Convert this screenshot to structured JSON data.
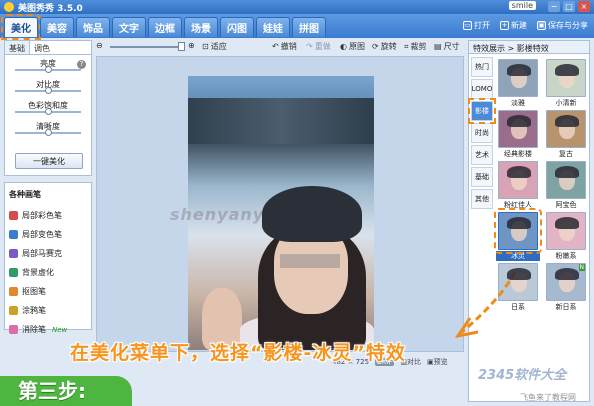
{
  "window": {
    "title": "美图秀秀 3.5.0",
    "user": "smile",
    "buttons": [
      "−",
      "□",
      "×"
    ]
  },
  "main_tabs": [
    "美化",
    "美容",
    "饰品",
    "文字",
    "边框",
    "场景",
    "闪图",
    "娃娃",
    "拼图"
  ],
  "top_actions": {
    "open": "打开",
    "new": "新建",
    "save_share": "保存与分享"
  },
  "left_panel": {
    "tabs": [
      "基础",
      "调色"
    ],
    "help": "?",
    "sliders": [
      {
        "label": "亮度",
        "value": 0.5
      },
      {
        "label": "对比度",
        "value": 0.5
      },
      {
        "label": "色彩饱和度",
        "value": 0.5
      },
      {
        "label": "清晰度",
        "value": 0.5
      }
    ],
    "onekey_button": "一键美化"
  },
  "brush_panel": {
    "title": "各种画笔",
    "items": [
      {
        "label": "局部彩色笔",
        "color": "#d64b4b"
      },
      {
        "label": "局部变色笔",
        "color": "#3b7bd0"
      },
      {
        "label": "局部马赛克",
        "color": "#7c5bc6"
      },
      {
        "label": "背景虚化",
        "color": "#2f9b6b"
      },
      {
        "label": "抠图笔",
        "color": "#e28a2b"
      },
      {
        "label": "涂鸦笔",
        "color": "#c9a227"
      },
      {
        "label": "消除笔",
        "color": "#e06aa8",
        "badge": "New"
      }
    ]
  },
  "toolbar": {
    "fit": "适应",
    "undo": "撤销",
    "redo": "重做",
    "original": "原图",
    "rotate": "旋转",
    "crop": "裁剪",
    "size": "尺寸"
  },
  "canvas": {
    "watermark": "shenyanya",
    "status": {
      "dimensions": "482 × 725",
      "exif": "EXIF",
      "compare": "对比",
      "preview": "预览"
    }
  },
  "right_panel": {
    "header": "特效展示 > 影楼特效",
    "categories": [
      "热门",
      "LOMO",
      "影楼",
      "时尚",
      "艺术",
      "基础",
      "其他"
    ],
    "active_category": "影楼",
    "thumbs": [
      {
        "label": "淡雅",
        "tone": "#8fa3b9"
      },
      {
        "label": "小清新",
        "tone": "#c7d6c8"
      },
      {
        "label": "经典影楼",
        "tone": "#9a6e8a"
      },
      {
        "label": "复古",
        "tone": "#b7946b"
      },
      {
        "label": "粉红佳人",
        "tone": "#d9a3b6"
      },
      {
        "label": "阿宝色",
        "tone": "#7fa3a3"
      },
      {
        "label": "冰灵",
        "tone": "#6f95c4",
        "selected": true
      },
      {
        "label": "粉嫩系",
        "tone": "#e2b4c4"
      },
      {
        "label": "日系",
        "tone": "#b9c9d8"
      },
      {
        "label": "新日系",
        "tone": "#a6b9cf",
        "new": true
      }
    ]
  },
  "overlay": {
    "caption": "在美化菜单下，选择“影楼-冰灵”特效",
    "step": "第三步:",
    "site": "2345软件大全",
    "site_sub": "飞鱼来了教程网"
  },
  "colors": {
    "accent_orange": "#f08a1a",
    "step_green": "#4fb541",
    "tab_blue": "#3b7bd0"
  }
}
